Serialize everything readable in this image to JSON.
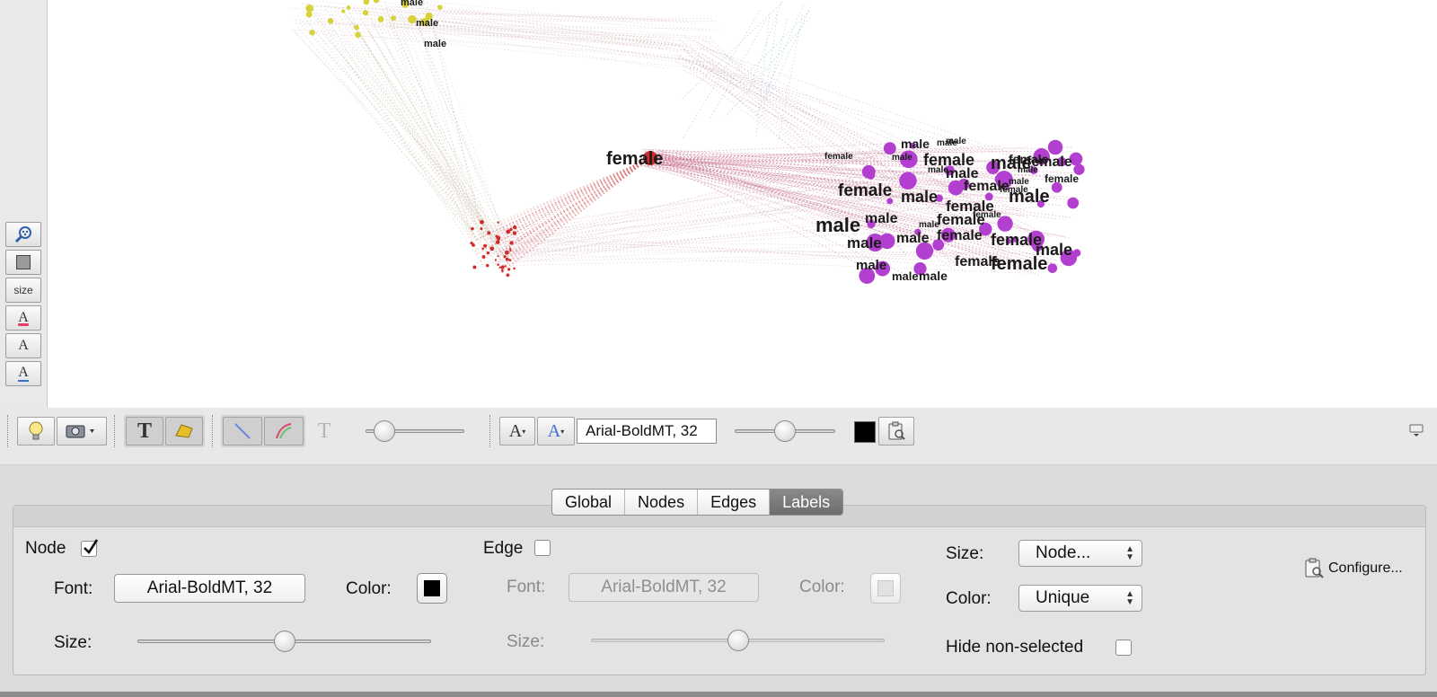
{
  "left_toolbar": {
    "items": [
      {
        "name": "zoom-icon",
        "glyph": "🔍"
      },
      {
        "name": "rectangle-select-icon",
        "glyph": ""
      },
      {
        "name": "size-tool",
        "label": "size"
      },
      {
        "name": "label-color-icon",
        "glyph": "A"
      },
      {
        "name": "label-size-icon",
        "glyph": "A"
      },
      {
        "name": "label-adjust-icon",
        "glyph": "A"
      }
    ]
  },
  "graph": {
    "center_label": "female",
    "cluster_labels": [
      "male",
      "female",
      "male",
      "female",
      "male",
      "female",
      "male",
      "female",
      "male",
      "female",
      "female",
      "male",
      "female",
      "male",
      "male",
      "male",
      "female",
      "female",
      "male",
      "female",
      "male",
      "female",
      "male",
      "male",
      "female"
    ],
    "small_labels": [
      "male",
      "male",
      "male",
      "male",
      "female",
      "male",
      "male",
      "female",
      "male",
      "female"
    ],
    "top_labels": [
      "male",
      "male",
      "male"
    ],
    "colors": {
      "cluster": "#b23fcf",
      "center": "#d22b2b",
      "top": "#d8d23a"
    }
  },
  "toolbar": {
    "font_value": "Arial-BoldMT, 32",
    "color": "#000000"
  },
  "tabs": [
    {
      "label": "Global",
      "active": false
    },
    {
      "label": "Nodes",
      "active": false
    },
    {
      "label": "Edges",
      "active": false
    },
    {
      "label": "Labels",
      "active": true
    }
  ],
  "panel": {
    "node_label": "Node",
    "node_checked": true,
    "edge_label": "Edge",
    "edge_checked": false,
    "font_label": "Font:",
    "color_label": "Color:",
    "size_label": "Size:",
    "node_font": "Arial-BoldMT, 32",
    "edge_font": "Arial-BoldMT, 32",
    "size_mode_label": "Size:",
    "size_mode_value": "Node...",
    "color_mode_label": "Color:",
    "color_mode_value": "Unique",
    "hide_label": "Hide non-selected",
    "configure_label": "Configure...",
    "node_size_level": 0.5,
    "edge_size_level": 0.5
  }
}
